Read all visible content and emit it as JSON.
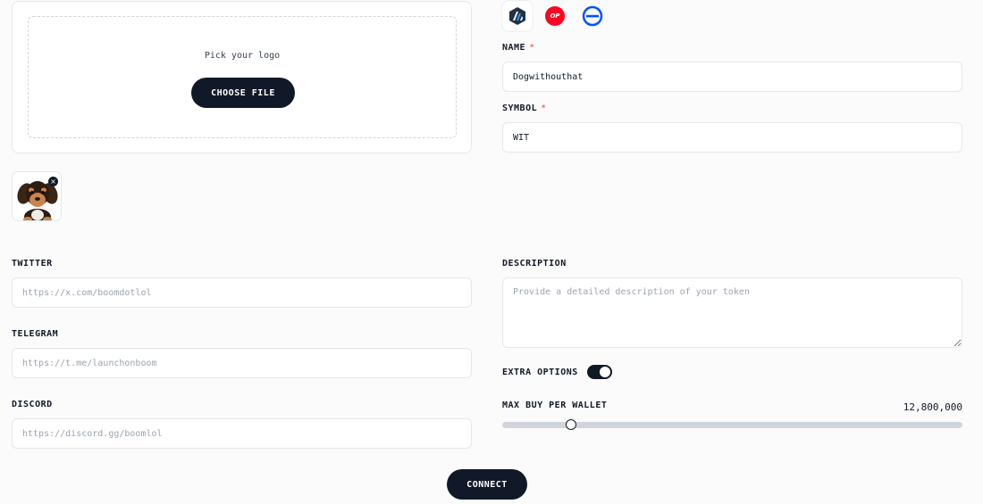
{
  "upload": {
    "prompt": "Pick your logo",
    "button_label": "CHOOSE FILE"
  },
  "chains": [
    {
      "icon": "arbitrum-icon",
      "color": "#213147",
      "selected": true
    },
    {
      "icon": "optimism-icon",
      "label": "OP",
      "color": "#ff0420"
    },
    {
      "icon": "base-icon",
      "color": "#0052ff"
    }
  ],
  "name": {
    "label": "NAME",
    "required_mark": "*",
    "value": "Dogwithouthat"
  },
  "symbol": {
    "label": "SYMBOL",
    "required_mark": "*",
    "value": "WIT"
  },
  "twitter": {
    "label": "TWITTER",
    "placeholder": "https://x.com/boomdotlol"
  },
  "telegram": {
    "label": "TELEGRAM",
    "placeholder": "https://t.me/launchonboom"
  },
  "discord": {
    "label": "DISCORD",
    "placeholder": "https://discord.gg/boomlol"
  },
  "description": {
    "label": "DESCRIPTION",
    "placeholder": "Provide a detailed description of your token"
  },
  "extra_options": {
    "label": "EXTRA OPTIONS",
    "enabled": true
  },
  "max_buy": {
    "label": "MAX BUY PER WALLET",
    "value_text": "12,800,000",
    "slider_fraction": 0.15
  },
  "connect_label": "CONNECT",
  "colors": {
    "accent": "#111827",
    "required": "#e0524a",
    "track": "#d1d5db"
  }
}
